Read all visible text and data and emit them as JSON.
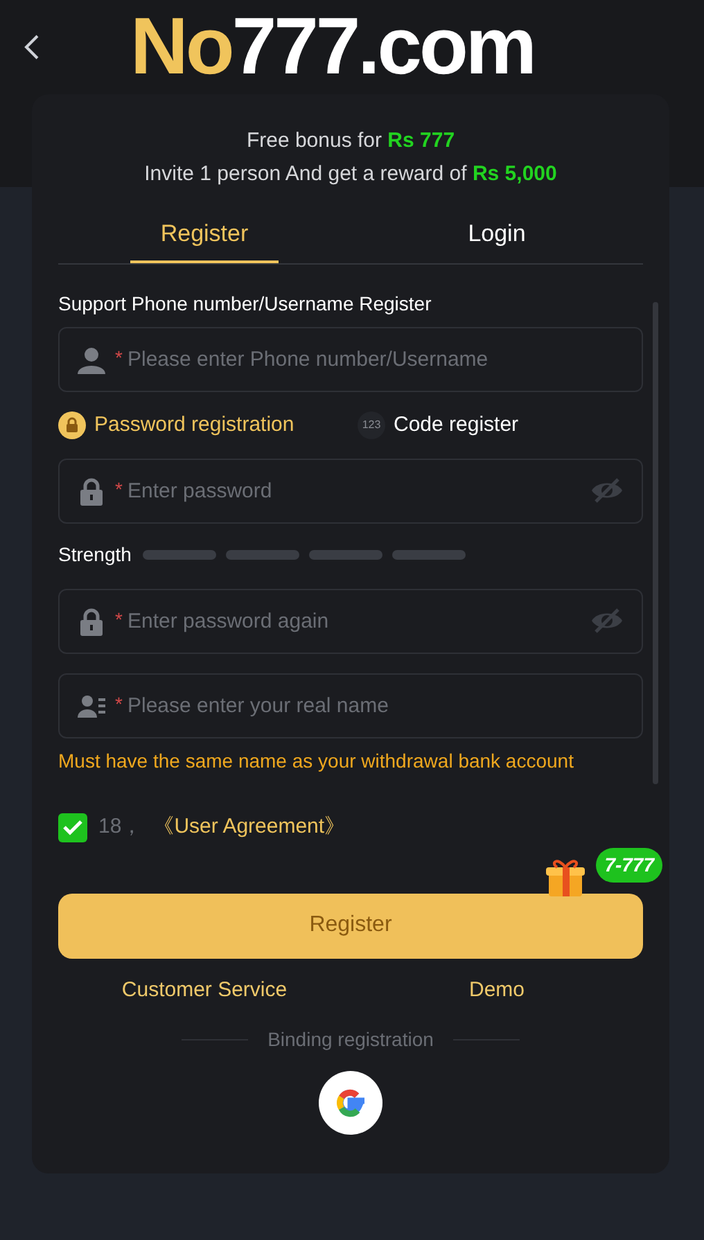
{
  "header": {
    "logo_primary": "No",
    "logo_secondary": "777.com"
  },
  "bonus": {
    "line_1": "Free bonus for **Rs 777**",
    "line_2": "Invite 1 person And get a reward of **Rs 5,000**"
  },
  "tabs": [
    {
      "label": "Register",
      "selected": true
    },
    {
      "label": "Login",
      "selected": false
    }
  ],
  "form_title": "Support Phone number/Username Register",
  "fields": [
    {
      "kind": "user",
      "marker": "*",
      "placeholder": "Please enter Phone number/Username",
      "toggle": false
    },
    {
      "kind": "modes"
    },
    {
      "kind": "lock",
      "marker": "*",
      "placeholder": "Enter password",
      "toggle": true
    },
    {
      "kind": "strength"
    },
    {
      "kind": "lock",
      "marker": "*",
      "placeholder": "Enter password again",
      "toggle": true
    },
    {
      "kind": "card",
      "marker": "*",
      "placeholder": "Please enter your real name",
      "toggle": false,
      "hint": "Must have the same name as your withdrawal bank account"
    }
  ],
  "modes": [
    {
      "kind": "lock",
      "label": "Password registration",
      "selected": true
    },
    {
      "kind": "digits",
      "label": "Code register",
      "icon_text": "123",
      "selected": false
    }
  ],
  "strength": {
    "label": "Strength"
  },
  "agreement": {
    "checked": true,
    "age": "18，",
    "link": "《User Agreement》"
  },
  "promo_badge": "7-777",
  "submit": "Register",
  "links": [
    "Customer Service",
    "Demo"
  ],
  "binding": {
    "label": "Binding registration"
  }
}
